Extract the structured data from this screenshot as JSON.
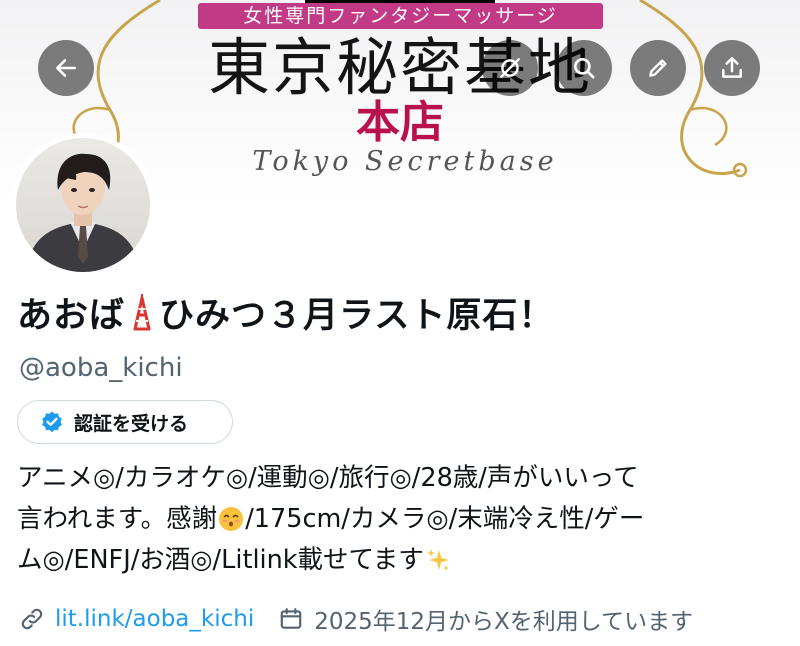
{
  "header": {
    "banner_tag": "女性専門ファンタジーマッサージ",
    "banner_title": "東京秘密基地",
    "banner_subtitle": "本店",
    "banner_script": "Tokyo Secretbase",
    "buttons": [
      {
        "name": "back-button",
        "icon": "arrow-left-icon"
      },
      {
        "name": "grok-button",
        "icon": "grok-icon"
      },
      {
        "name": "search-button",
        "icon": "search-icon"
      },
      {
        "name": "edit-button",
        "icon": "pencil-icon"
      },
      {
        "name": "share-button",
        "icon": "share-icon"
      }
    ]
  },
  "profile": {
    "name_before": "あおば",
    "name_after": "ひみつ３月ラスト原石！",
    "name_emoji": "tokyo-tower-icon",
    "handle": "@aoba_kichi",
    "verify_label": "認証を受ける",
    "bio_lines": [
      "アニメ◎/カラオケ◎/運動◎/旅行◎/28歳/声がいいって",
      [
        "言われます。感謝",
        "/175cm/カメラ◎/末端冷え性/ゲー"
      ],
      [
        "ム◎/ENFJ/お酒◎/Litlink載せてます",
        ""
      ]
    ],
    "bio_emojis": [
      "kissing-face-icon",
      "sparkles-icon"
    ],
    "link": "lit.link/aoba_kichi",
    "joined": "2025年12月からXを利用しています"
  },
  "colors": {
    "link": "#1d9bf0",
    "secondary_text": "#536471",
    "verified_badge": "#1d9bf0",
    "banner_tag_bg": "#c23a86",
    "banner_subtitle": "#b8114e"
  }
}
